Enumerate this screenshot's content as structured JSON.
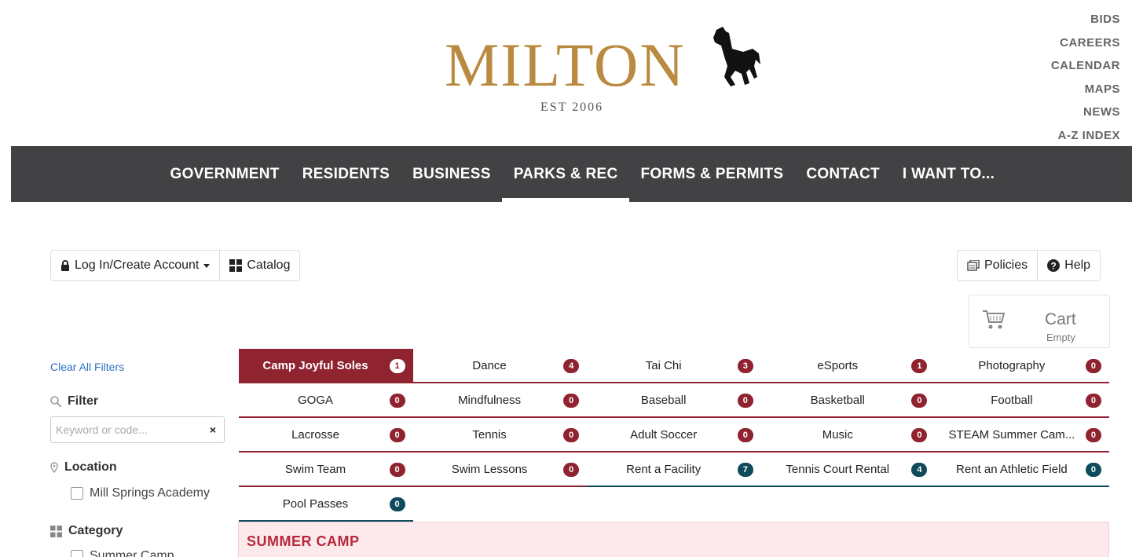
{
  "brand": {
    "name": "MILTON",
    "tagline": "EST 2006",
    "logo_color": "#b98a3f"
  },
  "utility_links": [
    "BIDS",
    "CAREERS",
    "CALENDAR",
    "MAPS",
    "NEWS",
    "A-Z INDEX"
  ],
  "nav": {
    "items": [
      "GOVERNMENT",
      "RESIDENTS",
      "BUSINESS",
      "PARKS & REC",
      "FORMS & PERMITS",
      "CONTACT",
      "I WANT TO..."
    ],
    "active": "PARKS & REC",
    "background": "#424244"
  },
  "toolbar": {
    "login_label": "Log In/Create Account",
    "catalog_label": "Catalog",
    "policies_label": "Policies",
    "help_label": "Help"
  },
  "cart": {
    "title": "Cart",
    "status": "Empty"
  },
  "sidebar": {
    "clear_filters": "Clear All Filters",
    "filter_label": "Filter",
    "search_placeholder": "Keyword or code...",
    "clear_symbol": "×",
    "location_label": "Location",
    "location_option": "Mill Springs Academy",
    "category_label": "Category",
    "category_option": "Summer Camp"
  },
  "categories": {
    "rows": [
      [
        {
          "name": "Camp Joyful Soles",
          "count": "1",
          "color": "red",
          "active": true
        },
        {
          "name": "Dance",
          "count": "4",
          "color": "red"
        },
        {
          "name": "Tai Chi",
          "count": "3",
          "color": "red"
        },
        {
          "name": "eSports",
          "count": "1",
          "color": "red"
        },
        {
          "name": "Photography",
          "count": "0",
          "color": "red"
        }
      ],
      [
        {
          "name": "GOGA",
          "count": "0",
          "color": "red"
        },
        {
          "name": "Mindfulness",
          "count": "0",
          "color": "red"
        },
        {
          "name": "Baseball",
          "count": "0",
          "color": "red"
        },
        {
          "name": "Basketball",
          "count": "0",
          "color": "red"
        },
        {
          "name": "Football",
          "count": "0",
          "color": "red"
        }
      ],
      [
        {
          "name": "Lacrosse",
          "count": "0",
          "color": "red"
        },
        {
          "name": "Tennis",
          "count": "0",
          "color": "red"
        },
        {
          "name": "Adult Soccer",
          "count": "0",
          "color": "red"
        },
        {
          "name": "Music",
          "count": "0",
          "color": "red"
        },
        {
          "name": "STEAM Summer Cam...",
          "count": "0",
          "color": "red"
        }
      ],
      [
        {
          "name": "Swim Team",
          "count": "0",
          "color": "red"
        },
        {
          "name": "Swim Lessons",
          "count": "0",
          "color": "red"
        },
        {
          "name": "Rent a Facility",
          "count": "7",
          "color": "teal"
        },
        {
          "name": "Tennis Court Rental",
          "count": "4",
          "color": "teal"
        },
        {
          "name": "Rent an Athletic Field",
          "count": "0",
          "color": "teal"
        }
      ],
      [
        {
          "name": "Pool Passes",
          "count": "0",
          "color": "teal"
        }
      ]
    ],
    "accent_red": "#8f2330",
    "accent_teal": "#0d4a5c"
  },
  "section": {
    "title": "SUMMER CAMP"
  }
}
